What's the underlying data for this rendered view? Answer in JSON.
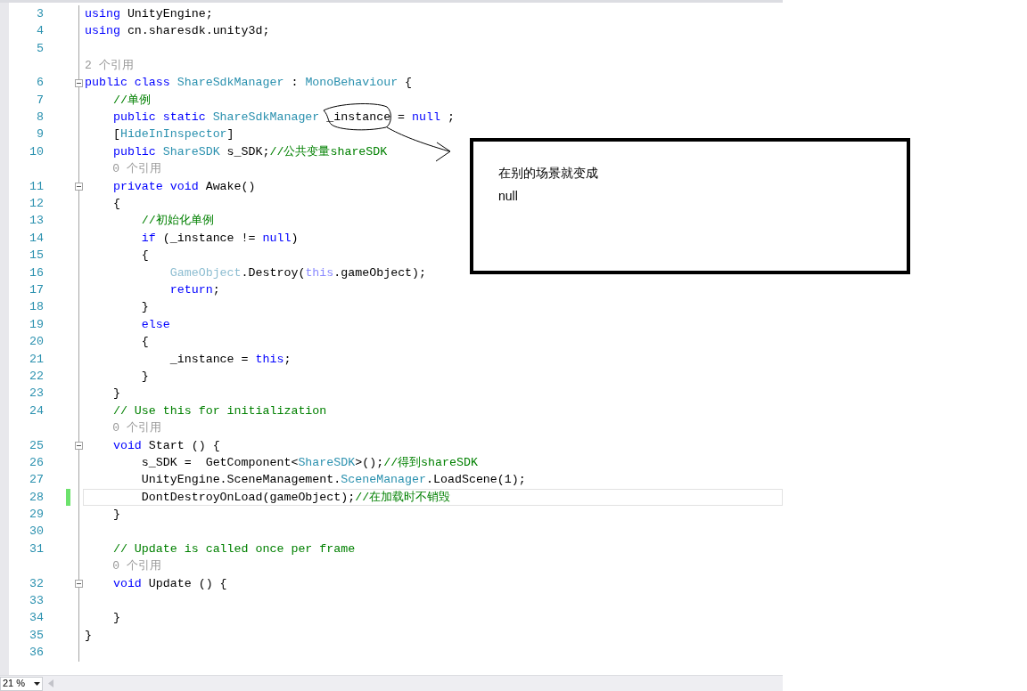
{
  "editor": {
    "lines": [
      {
        "number": "3",
        "fold": false,
        "changed": false,
        "current": false,
        "tokens": [
          {
            "kind": "keyword",
            "text": "using"
          },
          {
            "kind": "plain",
            "text": " UnityEngine;"
          }
        ]
      },
      {
        "number": "4",
        "fold": false,
        "changed": false,
        "current": false,
        "tokens": [
          {
            "kind": "keyword",
            "text": "using"
          },
          {
            "kind": "plain",
            "text": " cn.sharesdk.unity3d;"
          }
        ]
      },
      {
        "number": "5",
        "fold": false,
        "changed": false,
        "current": false
      },
      {
        "kind": "reference",
        "text": "2 个引用"
      },
      {
        "number": "6",
        "fold": true,
        "changed": false,
        "current": false,
        "tokens": [
          {
            "kind": "keyword",
            "text": "public class"
          },
          {
            "kind": "type",
            "text": " ShareSdkManager"
          },
          {
            "kind": "plain",
            "text": " : "
          },
          {
            "kind": "type",
            "text": "MonoBehaviour"
          },
          {
            "kind": "plain",
            "text": " {"
          }
        ]
      },
      {
        "number": "7",
        "fold": false,
        "changed": false,
        "current": false,
        "tokens": [
          {
            "kind": "comment",
            "text": "    //单例"
          }
        ]
      },
      {
        "number": "8",
        "fold": false,
        "changed": false,
        "current": false,
        "tokens": [
          {
            "kind": "keyword",
            "text": "    public static"
          },
          {
            "kind": "type",
            "text": " ShareSdkManager"
          },
          {
            "kind": "plain",
            "text": " _instance = "
          },
          {
            "kind": "keyword",
            "text": "null"
          },
          {
            "kind": "plain",
            "text": " ;"
          }
        ]
      },
      {
        "number": "9",
        "fold": false,
        "changed": false,
        "current": false,
        "tokens": [
          {
            "kind": "plain",
            "text": "    ["
          },
          {
            "kind": "type",
            "text": "HideInInspector"
          },
          {
            "kind": "plain",
            "text": "]"
          }
        ]
      },
      {
        "number": "10",
        "fold": false,
        "changed": false,
        "current": false,
        "tokens": [
          {
            "kind": "keyword",
            "text": "    public"
          },
          {
            "kind": "type",
            "text": " ShareSDK"
          },
          {
            "kind": "plain",
            "text": " s_SDK;"
          },
          {
            "kind": "comment",
            "text": "//公共变量shareSDK"
          }
        ]
      },
      {
        "kind": "reference",
        "text": "    0 个引用"
      },
      {
        "number": "11",
        "fold": true,
        "changed": false,
        "current": false,
        "tokens": [
          {
            "kind": "keyword",
            "text": "    private void"
          },
          {
            "kind": "plain",
            "text": " Awake()"
          }
        ]
      },
      {
        "number": "12",
        "fold": false,
        "changed": false,
        "current": false,
        "tokens": [
          {
            "kind": "plain",
            "text": "    {"
          }
        ]
      },
      {
        "number": "13",
        "fold": false,
        "changed": false,
        "current": false,
        "tokens": [
          {
            "kind": "comment",
            "text": "        //初始化单例"
          }
        ]
      },
      {
        "number": "14",
        "fold": false,
        "changed": false,
        "current": false,
        "tokens": [
          {
            "kind": "keyword",
            "text": "        if"
          },
          {
            "kind": "plain",
            "text": " (_instance != "
          },
          {
            "kind": "keyword",
            "text": "null"
          },
          {
            "kind": "plain",
            "text": ")"
          }
        ]
      },
      {
        "number": "15",
        "fold": false,
        "changed": false,
        "current": false,
        "tokens": [
          {
            "kind": "plain",
            "text": "        {"
          }
        ]
      },
      {
        "number": "16",
        "fold": false,
        "changed": false,
        "current": false,
        "tokens": [
          {
            "kind": "type_dim",
            "text": "            GameObject"
          },
          {
            "kind": "plain",
            "text": ".Destroy("
          },
          {
            "kind": "keyword_dim",
            "text": "this"
          },
          {
            "kind": "plain",
            "text": ".gameObject);"
          }
        ]
      },
      {
        "number": "17",
        "fold": false,
        "changed": false,
        "current": false,
        "tokens": [
          {
            "kind": "keyword",
            "text": "            return"
          },
          {
            "kind": "plain",
            "text": ";"
          }
        ]
      },
      {
        "number": "18",
        "fold": false,
        "changed": false,
        "current": false,
        "tokens": [
          {
            "kind": "plain",
            "text": "        }"
          }
        ]
      },
      {
        "number": "19",
        "fold": false,
        "changed": false,
        "current": false,
        "tokens": [
          {
            "kind": "keyword",
            "text": "        else"
          }
        ]
      },
      {
        "number": "20",
        "fold": false,
        "changed": false,
        "current": false,
        "tokens": [
          {
            "kind": "plain",
            "text": "        {"
          }
        ]
      },
      {
        "number": "21",
        "fold": false,
        "changed": false,
        "current": false,
        "tokens": [
          {
            "kind": "plain",
            "text": "            _instance = "
          },
          {
            "kind": "keyword",
            "text": "this"
          },
          {
            "kind": "plain",
            "text": ";"
          }
        ]
      },
      {
        "number": "22",
        "fold": false,
        "changed": false,
        "current": false,
        "tokens": [
          {
            "kind": "plain",
            "text": "        }"
          }
        ]
      },
      {
        "number": "23",
        "fold": false,
        "changed": false,
        "current": false,
        "tokens": [
          {
            "kind": "plain",
            "text": "    }"
          }
        ]
      },
      {
        "number": "24",
        "fold": false,
        "changed": false,
        "current": false,
        "tokens": [
          {
            "kind": "comment",
            "text": "    // Use this for initialization"
          }
        ]
      },
      {
        "kind": "reference",
        "text": "    0 个引用"
      },
      {
        "number": "25",
        "fold": true,
        "changed": false,
        "current": false,
        "tokens": [
          {
            "kind": "keyword",
            "text": "    void"
          },
          {
            "kind": "plain",
            "text": " Start () {"
          }
        ]
      },
      {
        "number": "26",
        "fold": false,
        "changed": false,
        "current": false,
        "tokens": [
          {
            "kind": "plain",
            "text": "        s_SDK =  GetComponent<"
          },
          {
            "kind": "type",
            "text": "ShareSDK"
          },
          {
            "kind": "plain",
            "text": ">();"
          },
          {
            "kind": "comment",
            "text": "//得到shareSDK"
          }
        ]
      },
      {
        "number": "27",
        "fold": false,
        "changed": false,
        "current": false,
        "tokens": [
          {
            "kind": "plain",
            "text": "        UnityEngine.SceneManagement."
          },
          {
            "kind": "type",
            "text": "SceneManager"
          },
          {
            "kind": "plain",
            "text": ".LoadScene(1);"
          }
        ]
      },
      {
        "number": "28",
        "fold": false,
        "changed": true,
        "current": true,
        "tokens": [
          {
            "kind": "plain",
            "text": "        DontDestroyOnLoad(gameObject);"
          },
          {
            "kind": "comment",
            "text": "//在加载时不销毁"
          }
        ]
      },
      {
        "number": "29",
        "fold": false,
        "changed": false,
        "current": false,
        "tokens": [
          {
            "kind": "plain",
            "text": "    }"
          }
        ]
      },
      {
        "number": "30",
        "fold": false,
        "changed": false,
        "current": false
      },
      {
        "number": "31",
        "fold": false,
        "changed": false,
        "current": false,
        "tokens": [
          {
            "kind": "comment",
            "text": "    // Update is called once per frame"
          }
        ]
      },
      {
        "kind": "reference",
        "text": "    0 个引用"
      },
      {
        "number": "32",
        "fold": true,
        "changed": false,
        "current": false,
        "tokens": [
          {
            "kind": "keyword",
            "text": "    void"
          },
          {
            "kind": "plain",
            "text": " Update () {"
          }
        ]
      },
      {
        "number": "33",
        "fold": false,
        "changed": false,
        "current": false
      },
      {
        "number": "34",
        "fold": false,
        "changed": false,
        "current": false,
        "tokens": [
          {
            "kind": "plain",
            "text": "    }"
          }
        ]
      },
      {
        "number": "35",
        "fold": false,
        "changed": false,
        "current": false,
        "tokens": [
          {
            "kind": "plain",
            "text": "}"
          }
        ]
      },
      {
        "number": "36",
        "fold": false,
        "changed": false,
        "current": false
      }
    ]
  },
  "callout": {
    "lines": [
      "在别的场景就变成",
      "null"
    ]
  },
  "status_bar": {
    "zoom": "21 %"
  }
}
